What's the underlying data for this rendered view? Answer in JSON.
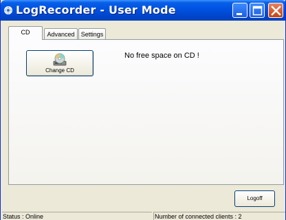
{
  "window": {
    "title": "LogRecorder - User Mode",
    "icon": "app-icon",
    "controls": {
      "minimize": "minimize-icon",
      "maximize": "maximize-icon",
      "close": "close-icon"
    }
  },
  "tabs": [
    {
      "label": "CD",
      "active": true
    },
    {
      "label": "Advanced",
      "active": false
    },
    {
      "label": "Settings",
      "active": false
    }
  ],
  "cd_panel": {
    "change_cd_label": "Change CD",
    "change_cd_icon": "cd-drive-icon",
    "message": "No free space on CD !"
  },
  "logoff_label": "Logoff",
  "status_bar": {
    "status": "Status : Online",
    "clients": "Number of connected clients : 2"
  },
  "colors": {
    "titlebar": "#0054e3",
    "window_bg": "#ece9d8",
    "close_button": "#c7410e"
  }
}
